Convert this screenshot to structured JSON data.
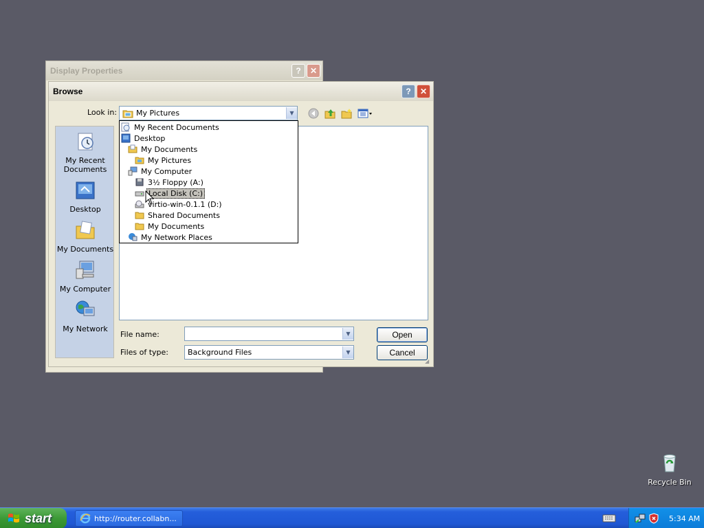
{
  "desktop": {
    "recycle_bin_label": "Recycle Bin"
  },
  "background_window": {
    "title": "Display Properties",
    "help_glyph": "?",
    "close_glyph": "✕"
  },
  "dialog": {
    "title": "Browse",
    "help_glyph": "?",
    "close_glyph": "✕",
    "look_in_label": "Look in:",
    "look_in_value": "My Pictures",
    "places": [
      {
        "label": "My Recent Documents",
        "icon": "recent-documents-icon"
      },
      {
        "label": "Desktop",
        "icon": "desktop-icon"
      },
      {
        "label": "My Documents",
        "icon": "my-documents-icon"
      },
      {
        "label": "My Computer",
        "icon": "my-computer-icon"
      },
      {
        "label": "My Network",
        "icon": "my-network-icon"
      }
    ],
    "dropdown_items": [
      {
        "label": "My Recent Documents",
        "icon": "recent-documents-icon",
        "indent": 0
      },
      {
        "label": "Desktop",
        "icon": "desktop-icon",
        "indent": 0
      },
      {
        "label": "My Documents",
        "icon": "folder-icon",
        "indent": 1
      },
      {
        "label": "My Pictures",
        "icon": "pictures-folder-icon",
        "indent": 2
      },
      {
        "label": "My Computer",
        "icon": "computer-icon",
        "indent": 1
      },
      {
        "label": "3½ Floppy (A:)",
        "icon": "floppy-icon",
        "indent": 2
      },
      {
        "label": "Local Disk (C:)",
        "icon": "hard-disk-icon",
        "indent": 2,
        "hover": true
      },
      {
        "label": "virtio-win-0.1.1 (D:)",
        "icon": "cd-drive-icon",
        "indent": 2
      },
      {
        "label": "Shared Documents",
        "icon": "folder-icon",
        "indent": 2
      },
      {
        "label": "My Documents",
        "icon": "folder-icon",
        "indent": 2
      },
      {
        "label": "My Network Places",
        "icon": "network-places-icon",
        "indent": 1
      }
    ],
    "file_name_label": "File name:",
    "file_name_value": "",
    "files_of_type_label": "Files of type:",
    "files_of_type_value": "Background Files",
    "open_label": "Open",
    "cancel_label": "Cancel"
  },
  "taskbar": {
    "start_label": "start",
    "task_button_label": "http://router.collabn...",
    "clock": "5:34 AM"
  },
  "colors": {
    "desktop_bg": "#5a5a66",
    "dialog_face": "#ece9d8",
    "taskbar_blue": "#245edb",
    "start_green": "#3c9a36"
  }
}
